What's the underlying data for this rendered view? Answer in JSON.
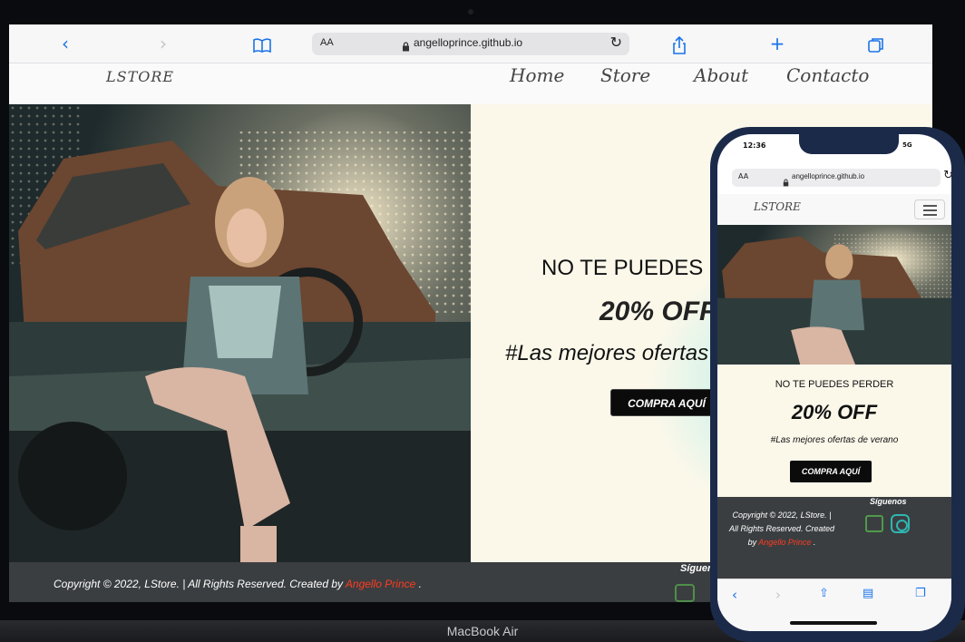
{
  "device": {
    "label": "MacBook Air"
  },
  "browser": {
    "address": "angelloprince.github.io",
    "aa_label": "AA",
    "icons": [
      "back-icon",
      "forward-icon",
      "bookmarks-icon",
      "lock-icon",
      "reload-icon",
      "share-icon",
      "new-tab-icon",
      "tabs-icon"
    ]
  },
  "site": {
    "brand": "LSTORE",
    "nav": [
      "Home",
      "Store",
      "About",
      "Contacto"
    ],
    "promo": {
      "line1": "NO TE PUEDES PERDER",
      "line1_visible_desktop": "NO TE PUEDES P",
      "line2": "20% OFF",
      "line2_visible_desktop": "20% OFF",
      "line3": "#Las mejores ofertas de verano",
      "line3_visible_desktop": "#Las mejores ofertas",
      "button": "COMPRA AQUÍ"
    },
    "footer": {
      "copyright": "Copyright © 2022, LStore. | All Rights Reserved. Created by",
      "author": "Angello Prince",
      "period": ".",
      "follow_desktop": "Síguen",
      "follow": "Síguenos",
      "mobile_copy_lines": [
        "Copyright © 2022, LStore. |",
        "All Rights Reserved. Created",
        "by"
      ]
    }
  },
  "phone": {
    "time": "12:36",
    "status": "5G",
    "address": "angelloprince.github.io",
    "aa_label": "AA"
  },
  "colors": {
    "accent": "#1a73e8",
    "author": "#ff3b1f",
    "promo_bg": "#fbf8ea",
    "footer_bg": "#3b3e41",
    "phone_frame": "#1c2a4a"
  }
}
